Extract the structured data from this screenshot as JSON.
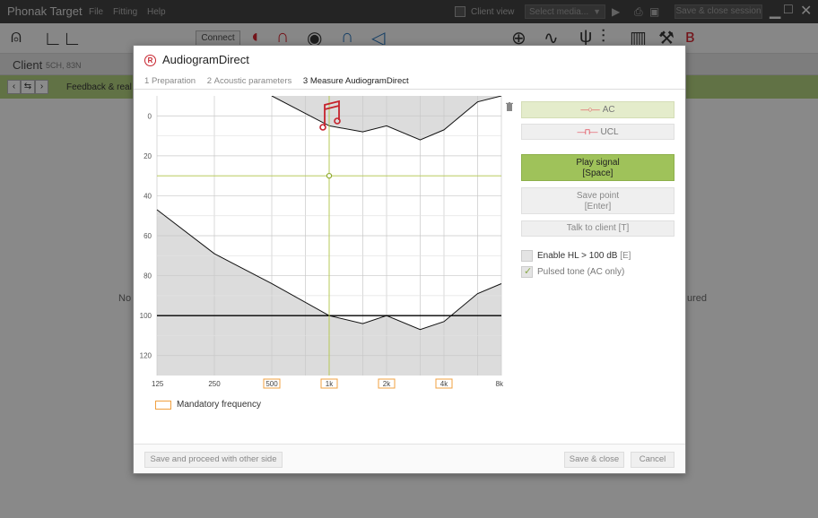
{
  "app": {
    "title": "Phonak Target",
    "menu": [
      "File",
      "Fitting",
      "Help"
    ],
    "client_view_label": "Client view",
    "media_placeholder": "Select media...",
    "save_session_label": "Save & close session",
    "connect_label": "Connect"
  },
  "client": {
    "label": "Client",
    "sub": "5CH, 83N",
    "feedback_label": "Feedback & real e",
    "bg_left": "No",
    "bg_right": "ured"
  },
  "dialog": {
    "badge": "R",
    "title": "AudiogramDirect",
    "steps": [
      {
        "num": "1",
        "label": "Preparation"
      },
      {
        "num": "2",
        "label": "Acoustic parameters"
      },
      {
        "num": "3",
        "label": "Measure AudiogramDirect"
      }
    ],
    "legend_label": "Mandatory frequency",
    "buttons": {
      "ac_symbol": "—○—",
      "ac": "AC",
      "ucl_symbol": "—⊓—",
      "ucl": "UCL",
      "play_line1": "Play signal",
      "play_line2": "[Space]",
      "save_line1": "Save point",
      "save_line2": "[Enter]",
      "talk": "Talk to client [T]"
    },
    "checkboxes": {
      "enable_hl": "Enable HL > 100 dB",
      "enable_hl_hint": "[E]",
      "pulsed": "Pulsed tone (AC only)"
    },
    "footer": {
      "proceed": "Save and proceed with other side",
      "save_close": "Save & close",
      "cancel": "Cancel"
    }
  },
  "chart_data": {
    "type": "line",
    "x_ticks": [
      "125",
      "250",
      "500",
      "1k",
      "2k",
      "4k",
      "8k"
    ],
    "mandatory_frequencies": [
      "500",
      "1k",
      "2k",
      "4k"
    ],
    "y_ticks": [
      0,
      20,
      40,
      60,
      80,
      100,
      120
    ],
    "ylim": [
      -10,
      130
    ],
    "y_inverted": true,
    "x_scale": "log",
    "cursor": {
      "freq": 1000,
      "db": 30
    },
    "reference_line_db": 100,
    "top_curve": [
      [
        500,
        -10
      ],
      [
        1000,
        5
      ],
      [
        1500,
        8
      ],
      [
        2000,
        5
      ],
      [
        3000,
        12
      ],
      [
        4000,
        7
      ],
      [
        6000,
        -7
      ],
      [
        8000,
        -10
      ]
    ],
    "bottom_curve": [
      [
        125,
        47
      ],
      [
        250,
        69
      ],
      [
        500,
        84
      ],
      [
        1000,
        100
      ],
      [
        1500,
        104
      ],
      [
        2000,
        100
      ],
      [
        3000,
        107
      ],
      [
        4000,
        103
      ],
      [
        6000,
        89
      ],
      [
        8000,
        84
      ]
    ],
    "grid": true,
    "colors": {
      "shade": "#dcdcdc",
      "cursor": "#b4c84a",
      "marker": "#c6232d",
      "mandatory": "#f0a040"
    }
  }
}
